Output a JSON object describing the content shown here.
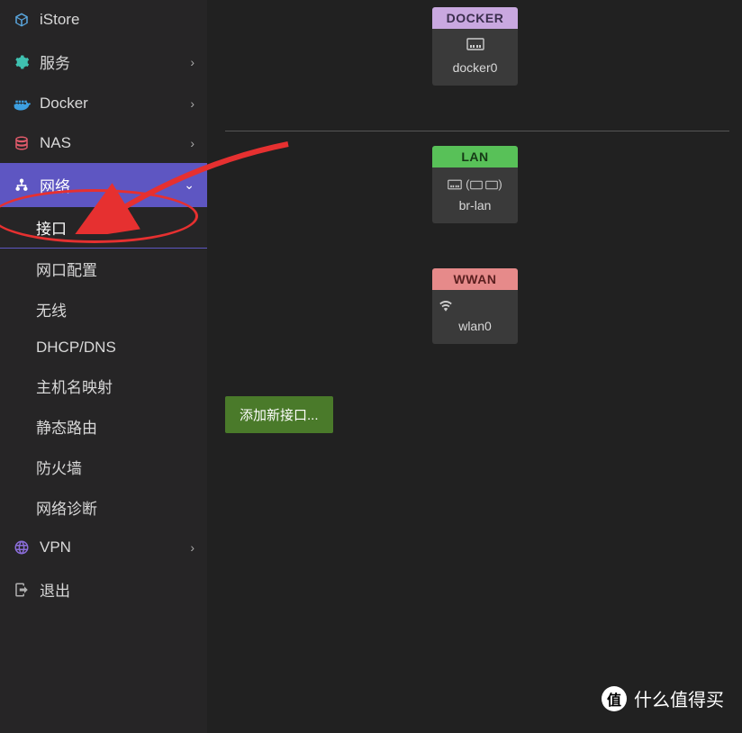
{
  "sidebar": {
    "items": [
      {
        "label": "iStore",
        "icon": "cube-icon",
        "color": "#5aa8e0",
        "hasChevron": false
      },
      {
        "label": "服务",
        "icon": "gears-icon",
        "color": "#3fc1b0",
        "hasChevron": true
      },
      {
        "label": "Docker",
        "icon": "docker-icon",
        "color": "#3d9fe0",
        "hasChevron": true
      },
      {
        "label": "NAS",
        "icon": "database-icon",
        "color": "#e05a6a",
        "hasChevron": true
      },
      {
        "label": "网络",
        "icon": "network-icon",
        "color": "#ffffff",
        "hasChevron": true,
        "expanded": true
      },
      {
        "label": "VPN",
        "icon": "globe-icon",
        "color": "#8a6dd8",
        "hasChevron": true
      },
      {
        "label": "退出",
        "icon": "logout-icon",
        "color": "#b0b0b0",
        "hasChevron": false
      }
    ],
    "submenu": [
      {
        "label": "接口",
        "selected": true
      },
      {
        "label": "网口配置"
      },
      {
        "label": "无线"
      },
      {
        "label": "DHCP/DNS"
      },
      {
        "label": "主机名映射"
      },
      {
        "label": "静态路由"
      },
      {
        "label": "防火墙"
      },
      {
        "label": "网络诊断"
      }
    ]
  },
  "interfaces": [
    {
      "badge": "DOCKER",
      "badgeClass": "badge-purple",
      "iconText": "⏍⏍",
      "name": "docker0"
    },
    {
      "badge": "LAN",
      "badgeClass": "badge-green",
      "iconText": "⏍⏍ (⎵ ⎵)",
      "name": "br-lan"
    },
    {
      "badge": "WWAN",
      "badgeClass": "badge-red",
      "iconText": "📶",
      "name": "wlan0"
    }
  ],
  "buttons": {
    "addInterface": "添加新接口..."
  },
  "watermark": {
    "iconChar": "值",
    "text": "什么值得买"
  }
}
